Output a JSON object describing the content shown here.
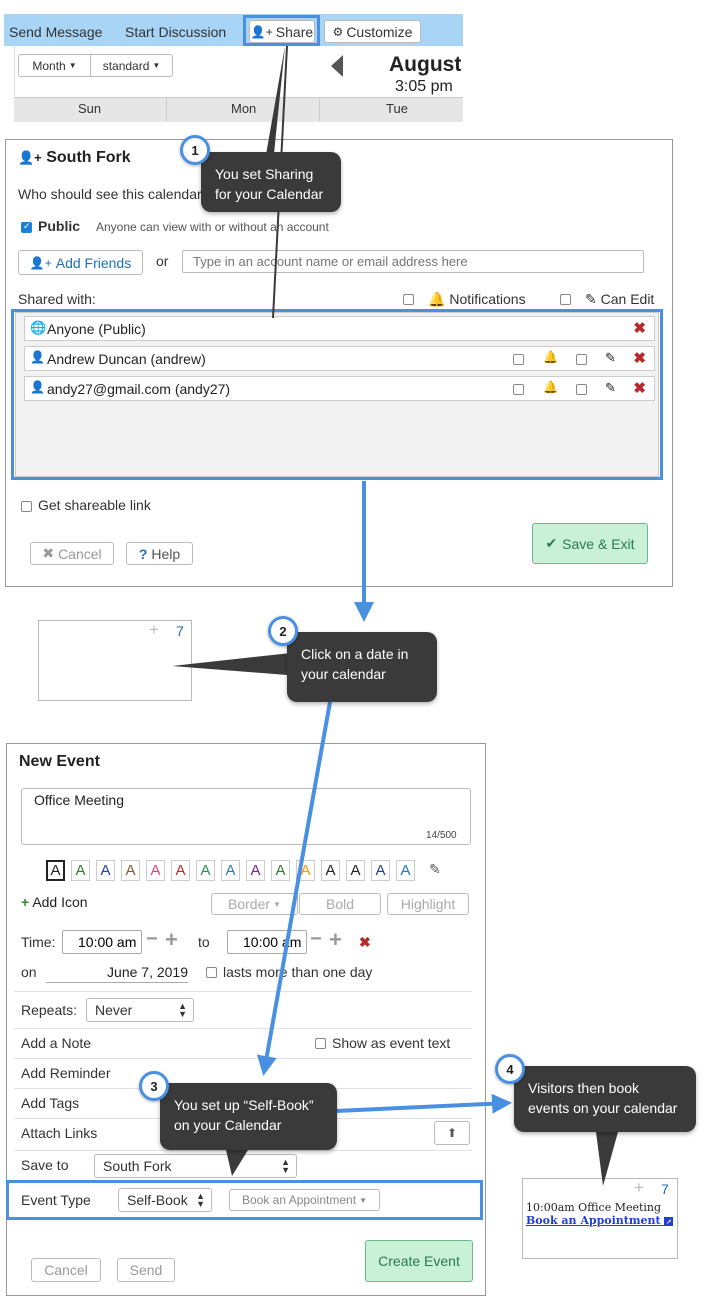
{
  "toolbar": {
    "send_message": "Send Message",
    "start_discussion": "Start Discussion",
    "share": "Share",
    "customize": "Customize",
    "month_select": "Month",
    "standard_select": "standard",
    "month_title": "August",
    "time": "3:05 pm",
    "days": [
      "Sun",
      "Mon",
      "Tue"
    ]
  },
  "share_dialog": {
    "title": "South Fork",
    "who_should_see": "Who should see this calendar?",
    "public_label": "Public",
    "public_desc": "Anyone can view with or without an account",
    "add_friends": "Add Friends",
    "or": "or",
    "input_placeholder": "Type in an account name or email address here",
    "shared_with": "Shared with:",
    "notifications": "Notifications",
    "can_edit": "Can Edit",
    "entries": [
      "Anyone (Public)",
      "Andrew Duncan (andrew)",
      "andy27@gmail.com (andy27)"
    ],
    "get_link": "Get shareable link",
    "cancel": "Cancel",
    "help": "Help",
    "save_exit": "Save & Exit"
  },
  "date_cell": {
    "plus": "+",
    "day": "7"
  },
  "new_event": {
    "title": "New Event",
    "text": "Office Meeting",
    "char_count": "14/500",
    "letter": "A",
    "letter_colors": [
      "#222222",
      "#2e7d32",
      "#1f3f9f",
      "#8b5a2b",
      "#e0457b",
      "#c62828",
      "#2e8b57",
      "#2a7fb8",
      "#7b1fa2",
      "#2e7d32",
      "#ff9800",
      "#222222",
      "#222222",
      "#1f3f9f",
      "#1f77c4"
    ],
    "add_icon": "Add Icon",
    "border": "Border",
    "bold": "Bold",
    "highlight": "Highlight",
    "time_label": "Time:",
    "start_time": "10:00 am",
    "to": "to",
    "end_time": "10:00 am",
    "on_label": "on",
    "date": "June 7, 2019",
    "multi_day": "lasts more than one day",
    "repeats_label": "Repeats:",
    "repeats_value": "Never",
    "add_note": "Add a Note",
    "show_as_text": "Show as event text",
    "add_reminder": "Add Reminder",
    "add_tags": "Add Tags",
    "attach_links": "Attach Links",
    "save_to_label": "Save to",
    "save_to_value": "South Fork",
    "event_type_label": "Event Type",
    "event_type_value": "Self-Book",
    "book_appointment": "Book an Appointment",
    "cancel": "Cancel",
    "send": "Send",
    "create": "Create Event"
  },
  "result_cell": {
    "plus": "+",
    "day": "7",
    "event": "10:00am Office Meeting",
    "link": "Book an Appointment"
  },
  "callouts": [
    {
      "num": "1",
      "text": "You set Sharing for your Calendar"
    },
    {
      "num": "2",
      "text": "Click on a date in your calendar"
    },
    {
      "num": "3",
      "text": "You set up “Self-Book” on your Calendar"
    },
    {
      "num": "4",
      "text": "Visitors then book events on your calendar"
    }
  ],
  "colors": {
    "highlight": "#4a90e2",
    "toolbar_bg": "#a8d4f5",
    "save_green": "#c9f1d8",
    "delete_red": "#b52b2b"
  }
}
